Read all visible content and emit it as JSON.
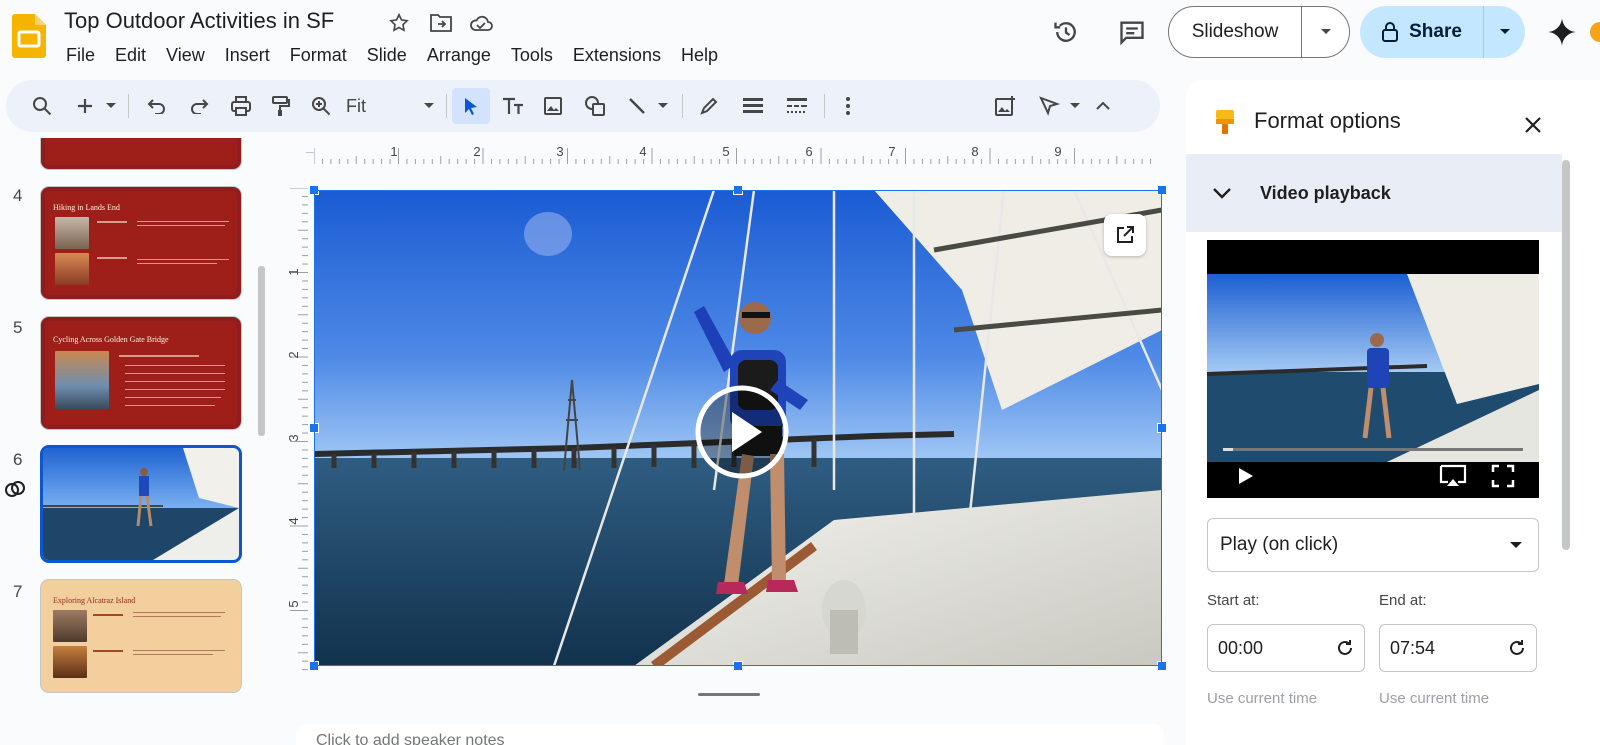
{
  "app": {
    "title": "Top Outdoor Activities in SF"
  },
  "menu": [
    "File",
    "Edit",
    "View",
    "Insert",
    "Format",
    "Slide",
    "Arrange",
    "Tools",
    "Extensions",
    "Help"
  ],
  "header": {
    "slideshow_label": "Slideshow",
    "share_label": "Share"
  },
  "toolbar": {
    "zoom_label": "Fit"
  },
  "ruler": {
    "h": [
      "1",
      "2",
      "3",
      "4",
      "5",
      "6",
      "7",
      "8",
      "9"
    ],
    "v": [
      "1",
      "2",
      "3",
      "4",
      "5"
    ]
  },
  "slides": [
    {
      "number": "4",
      "title": "Hiking in Lands End"
    },
    {
      "number": "5",
      "title": "Cycling Across Golden Gate Bridge"
    },
    {
      "number": "6",
      "title": ""
    },
    {
      "number": "7",
      "title": "Exploring Alcatraz Island"
    }
  ],
  "notes": {
    "placeholder": "Click to add speaker notes"
  },
  "panel": {
    "title": "Format options",
    "section": "Video playback",
    "play_mode": "Play (on click)",
    "start_label": "Start at:",
    "end_label": "End at:",
    "start_value": "00:00",
    "end_value": "07:54",
    "use_current": "Use current time"
  },
  "colors": {
    "accent": "#0b57d0",
    "share_bg": "#c2e7ff",
    "slide_red": "#9e1f1a",
    "slide_peach": "#f3cf9e"
  }
}
